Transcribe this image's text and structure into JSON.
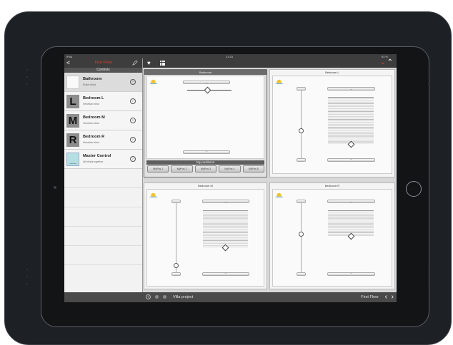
{
  "status_bar": {
    "carrier": "iPad",
    "time": "21:15",
    "battery": "93 %"
  },
  "sidebar": {
    "back_label": "<",
    "title": "First Floor",
    "section_label": "Controls",
    "items": [
      {
        "name": "Bathroom",
        "subtitle": "Roller blind",
        "thumb": ""
      },
      {
        "name": "Bedroom L",
        "subtitle": "Venetian blind",
        "thumb": "L"
      },
      {
        "name": "Bedroom M",
        "subtitle": "Venetian blind",
        "thumb": "M"
      },
      {
        "name": "Bedroom R",
        "subtitle": "Venetian blind",
        "thumb": "R"
      },
      {
        "name": "Master Control",
        "subtitle": "All blinds together",
        "thumb": "Control Panel"
      }
    ]
  },
  "panels": {
    "bathroom": {
      "title": "Bathroom"
    },
    "bedroom_l": {
      "title": "Bedroom L"
    },
    "bedroom_m": {
      "title": "Bedroom M"
    },
    "bedroom_r": {
      "title": "Bedroom R"
    }
  },
  "my_positions": {
    "title": "My positions",
    "buttons": [
      "MyPos 1",
      "MyPos 2",
      "MyPos 3",
      "MyPos 4",
      "MyPos 5"
    ]
  },
  "bottom_bar": {
    "project": "Villa project",
    "floor": "First Floor"
  },
  "icons": {
    "favorites": "heart-icon",
    "grid": "grid-icon",
    "collapse": "chevron-down-icon",
    "expand": "chevron-up-icon",
    "edit": "pencil-icon",
    "weather": "sun-icon",
    "help": "question-icon"
  },
  "colors": {
    "accent": "#e33b2e",
    "header": "#3d3d3d",
    "panel": "#f4f4f4"
  }
}
